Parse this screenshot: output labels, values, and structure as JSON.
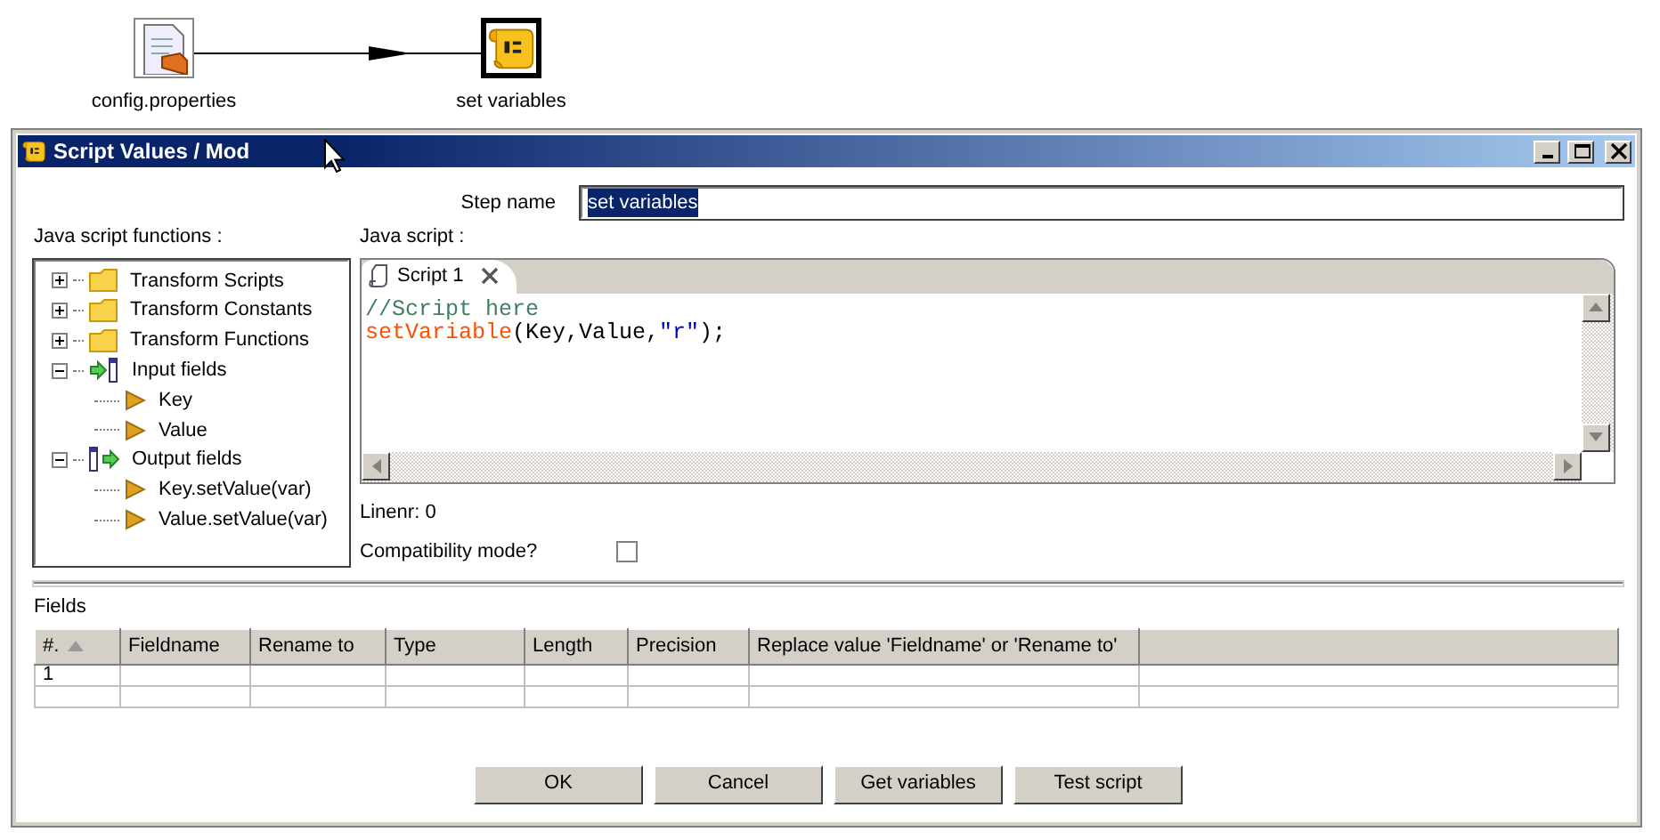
{
  "canvas": {
    "nodes": [
      {
        "label": "config.properties",
        "kind": "file",
        "selected": false
      },
      {
        "label": "set variables",
        "kind": "script",
        "selected": true
      }
    ]
  },
  "dialog": {
    "title": "Script Values / Mod",
    "step_name": {
      "label": "Step name",
      "value": "set variables"
    },
    "functions": {
      "label": "Java script functions :",
      "tree": [
        {
          "label": "Transform Scripts",
          "kind": "folder",
          "expanded": false
        },
        {
          "label": "Transform Constants",
          "kind": "folder",
          "expanded": false
        },
        {
          "label": "Transform Functions",
          "kind": "folder",
          "expanded": false
        },
        {
          "label": "Input fields",
          "kind": "input",
          "expanded": true,
          "children": [
            {
              "label": "Key"
            },
            {
              "label": "Value"
            }
          ]
        },
        {
          "label": "Output fields",
          "kind": "output",
          "expanded": true,
          "children": [
            {
              "label": "Key.setValue(var)"
            },
            {
              "label": "Value.setValue(var)"
            }
          ]
        }
      ]
    },
    "script": {
      "label": "Java script :",
      "tabs": [
        {
          "label": "Script 1",
          "selected": true
        }
      ],
      "lines": [
        [
          {
            "text": "//Script here",
            "kind": "comment"
          }
        ],
        [
          {
            "text": "setVariable",
            "kind": "function"
          },
          {
            "text": "(Key,Value,",
            "kind": "plain"
          },
          {
            "text": "\"r\"",
            "kind": "string"
          },
          {
            "text": ");",
            "kind": "plain"
          }
        ]
      ]
    },
    "linenr": "Linenr: 0",
    "compatibility": {
      "label": "Compatibility mode?",
      "checked": false
    },
    "fields": {
      "label": "Fields",
      "columns": [
        {
          "label": "#.",
          "sorted": true
        },
        {
          "label": "Fieldname",
          "sorted": false
        },
        {
          "label": "Rename to",
          "sorted": false
        },
        {
          "label": "Type",
          "sorted": false
        },
        {
          "label": "Length",
          "sorted": false
        },
        {
          "label": "Precision",
          "sorted": false
        },
        {
          "label": "Replace value 'Fieldname' or 'Rename to'",
          "sorted": false
        }
      ],
      "rows": [
        [
          "1"
        ]
      ]
    },
    "buttons": [
      "OK",
      "Cancel",
      "Get variables",
      "Test script"
    ]
  }
}
